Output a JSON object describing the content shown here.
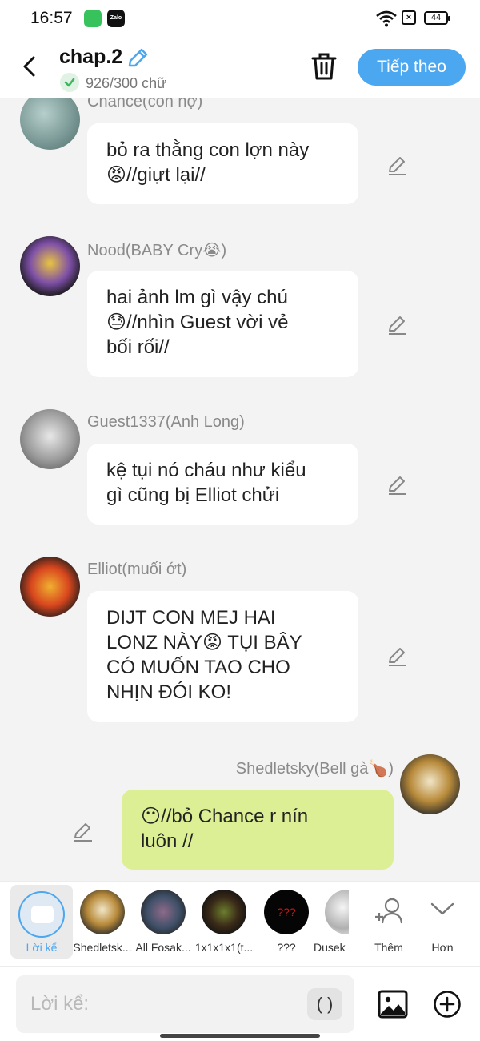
{
  "status_bar": {
    "time": "16:57",
    "app_icon_2": "Zalo",
    "battery": "44",
    "icons": [
      "app-green-icon",
      "zalo-icon",
      "wifi-icon",
      "no-sim-icon",
      "battery-icon"
    ]
  },
  "header": {
    "title": "chap.2",
    "word_count": "926/300 chữ",
    "next_label": "Tiếp theo",
    "accent_color": "#4ca7f1"
  },
  "messages": [
    {
      "name": "Chance(con nợ)",
      "lines": [
        "bỏ ra thằng con lợn này",
        "😡//giựt lại//"
      ],
      "side": "left"
    },
    {
      "name": "Nood(BABY Cry😭)",
      "lines": [
        "hai ảnh lm gì vậy chú",
        "😓//nhìn Guest vời vẻ",
        "bối rối//"
      ],
      "side": "left"
    },
    {
      "name": "Guest1337(Anh Long)",
      "lines": [
        "kệ tụi nó cháu như kiểu",
        "gì cũng bị Elliot chửi"
      ],
      "side": "left"
    },
    {
      "name": "Elliot(muối ớt)",
      "lines": [
        "DIJT CON MEJ HAI",
        "LONZ NÀY😡 TỤI BÂY",
        "CÓ MUỐN TAO CHO",
        "NHỊN ĐÓI KO!"
      ],
      "side": "left"
    },
    {
      "name": "Shedletsky(Bell gà🍗)",
      "lines": [
        "😶//bỏ Chance r nín",
        "luôn //"
      ],
      "side": "right",
      "bubble_color": "#dcef94"
    }
  ],
  "characters": [
    {
      "label": "Lời kể",
      "selected": true
    },
    {
      "label": "Shedletsk..."
    },
    {
      "label": "All Fosak..."
    },
    {
      "label": "1x1x1x1(t..."
    },
    {
      "label": "???"
    },
    {
      "label": "Dusek"
    }
  ],
  "character_tools": {
    "add_label": "Thêm",
    "more_label": "Hơn"
  },
  "input": {
    "placeholder": "Lời kể:",
    "paren_label": "( )"
  }
}
